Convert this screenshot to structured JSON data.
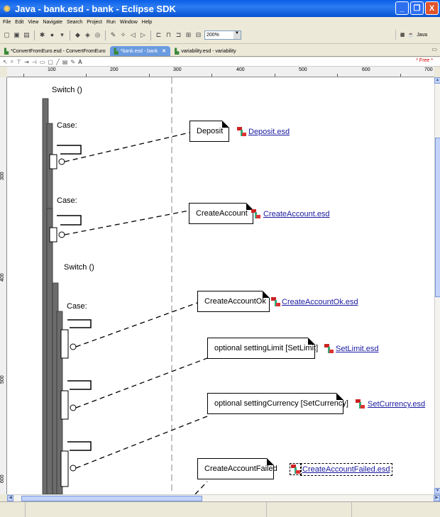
{
  "window": {
    "title": "Java - bank.esd - bank - Eclipse SDK",
    "controls": [
      "_",
      "❐",
      "X"
    ]
  },
  "menu": [
    "File",
    "Edit",
    "View",
    "Navigate",
    "Search",
    "Project",
    "Run",
    "Window",
    "Help"
  ],
  "toolbar": {
    "zoom": "200%",
    "perspective": "Java"
  },
  "tabs": [
    {
      "label": "*ConvertFromEuro.esd - ConvertFromEuro",
      "active": false
    },
    {
      "label": "*bank.esd - bank",
      "active": true
    },
    {
      "label": "variability.esd - variability",
      "active": false
    }
  ],
  "palette": {
    "free_label": "* Free *"
  },
  "ruler": {
    "h_labels": [
      "100",
      "200",
      "300",
      "400",
      "500",
      "600",
      "700"
    ],
    "v_labels": [
      "300",
      "400",
      "500",
      "600"
    ]
  },
  "diagram": {
    "switch1": "Switch ()",
    "case1": "Case:",
    "case2": "Case:",
    "switch2": "Switch ()",
    "case3": "Case:",
    "boxes": [
      {
        "label": "Deposit",
        "link": "Deposit.esd"
      },
      {
        "label": "CreateAccount",
        "link": "CreateAccount.esd"
      },
      {
        "label": "CreateAccountOk",
        "link": "CreateAccountOk.esd"
      },
      {
        "label": "optional  settingLimit [SetLimit]",
        "link": "SetLimit.esd"
      },
      {
        "label": "optional  settingCurrency [SetCurrency]",
        "link": "SetCurrency.esd"
      },
      {
        "label": "CreateAccountFailed",
        "link": "CreateAccountFailed.esd"
      }
    ]
  },
  "colors": {
    "titlebar": "#0a5fe8",
    "chrome": "#ece9d8",
    "lifeline": "#6c6c6c",
    "link": "#1a1aa0"
  }
}
